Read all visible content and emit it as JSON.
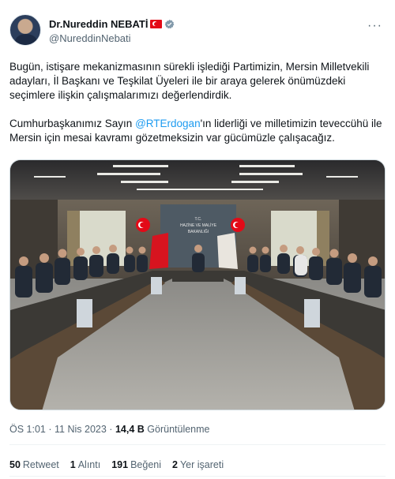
{
  "author": {
    "display_name": "Dr.Nureddin NEBATİ",
    "handle": "@NureddinNebati"
  },
  "tweet": {
    "paragraph1": "Bugün, istişare mekanizmasının sürekli işlediği Partimizin, Mersin Milletvekili adayları, İl Başkanı ve Teşkilat Üyeleri ile bir araya gelerek önümüzdeki seçimlere ilişkin çalışmalarımızı değerlendirdik.",
    "paragraph2_before": "Cumhurbaşkanımız Sayın ",
    "mention": "@RTErdogan",
    "paragraph2_after": "'ın liderliği ve milletimizin teveccühü ile Mersin için mesai kavramı gözetmeksizin var gücümüzle çalışacağız."
  },
  "photo": {
    "sign_line1": "T.C.",
    "sign_line2": "HAZİNE VE MALİYE",
    "sign_line3": "BAKANLIĞI"
  },
  "meta": {
    "time": "ÖS 1:01",
    "separator": "·",
    "date": "11 Nis 2023",
    "views_value": "14,4 B",
    "views_label": "Görüntülenme"
  },
  "stats": {
    "retweets_value": "50",
    "retweets_label": "Retweet",
    "quotes_value": "1",
    "quotes_label": "Alıntı",
    "likes_value": "191",
    "likes_label": "Beğeni",
    "bookmarks_value": "2",
    "bookmarks_label": "Yer işareti"
  },
  "colors": {
    "accent": "#1d9bf0",
    "text_secondary": "#536471",
    "flag_red": "#e30a17"
  }
}
